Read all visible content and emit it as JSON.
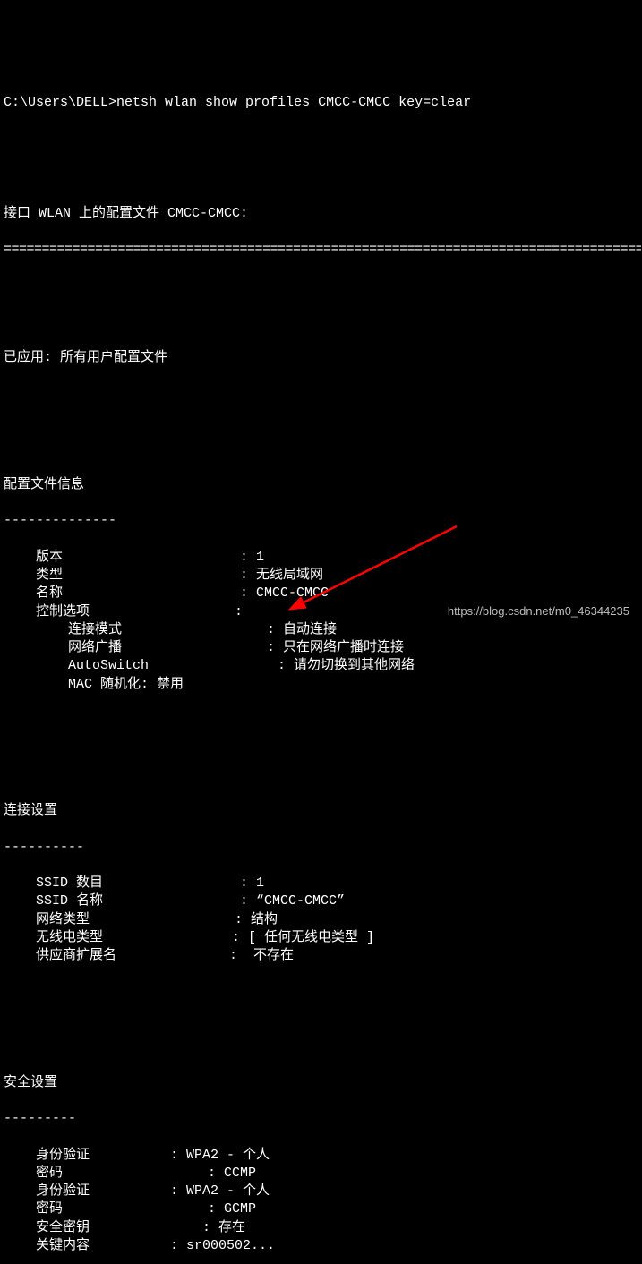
{
  "prompt": {
    "path": "C:\\Users\\DELL>",
    "command": "netsh wlan show profiles CMCC-CMCC key=clear"
  },
  "headerLine": "接口 WLAN 上的配置文件 CMCC-CMCC:",
  "appliedLabel": "已应用:",
  "appliedValue": "所有用户配置文件",
  "section1": {
    "title": "配置文件信息",
    "rows": [
      {
        "label": "版本",
        "value": "1"
      },
      {
        "label": "类型",
        "value": "无线局域网"
      },
      {
        "label": "名称",
        "value": "CMCC-CMCC"
      },
      {
        "label": "控制选项",
        "value": ""
      },
      {
        "label": "连接模式",
        "value": "自动连接",
        "indent": true
      },
      {
        "label": "网络广播",
        "value": "只在网络广播时连接",
        "indent": true
      },
      {
        "label": "AutoSwitch",
        "value": "请勿切换到其他网络",
        "indent": true
      },
      {
        "label": "MAC 随机化: 禁用",
        "value": null,
        "indent": true
      }
    ]
  },
  "section2": {
    "title": "连接设置",
    "rows": [
      {
        "label": "SSID 数目",
        "value": "1"
      },
      {
        "label": "SSID 名称",
        "value": "“CMCC-CMCC”"
      },
      {
        "label": "网络类型",
        "value": "结构"
      },
      {
        "label": "无线电类型",
        "value": "[ 任何无线电类型 ]"
      },
      {
        "label": "供应商扩展名",
        "value": " 不存在"
      }
    ]
  },
  "section3": {
    "title": "安全设置",
    "rows": [
      {
        "label": "身份验证",
        "colonCol": 18,
        "value": "WPA2 - 个人"
      },
      {
        "label": "密码",
        "colonCol": 22,
        "value": "CCMP"
      },
      {
        "label": "身份验证",
        "colonCol": 18,
        "value": "WPA2 - 个人"
      },
      {
        "label": "密码",
        "colonCol": 22,
        "value": "GCMP"
      },
      {
        "label": "安全密钥",
        "colonCol": 22,
        "value": "存在"
      },
      {
        "label": "关键内容",
        "colonCol": 18,
        "value": "sr000502..."
      }
    ]
  },
  "watermark": "https://blog.csdn.net/m0_46344235",
  "divEq": "========================================================================================",
  "divDash14": "--------------",
  "divDash10": "----------",
  "divDash9": "---------"
}
